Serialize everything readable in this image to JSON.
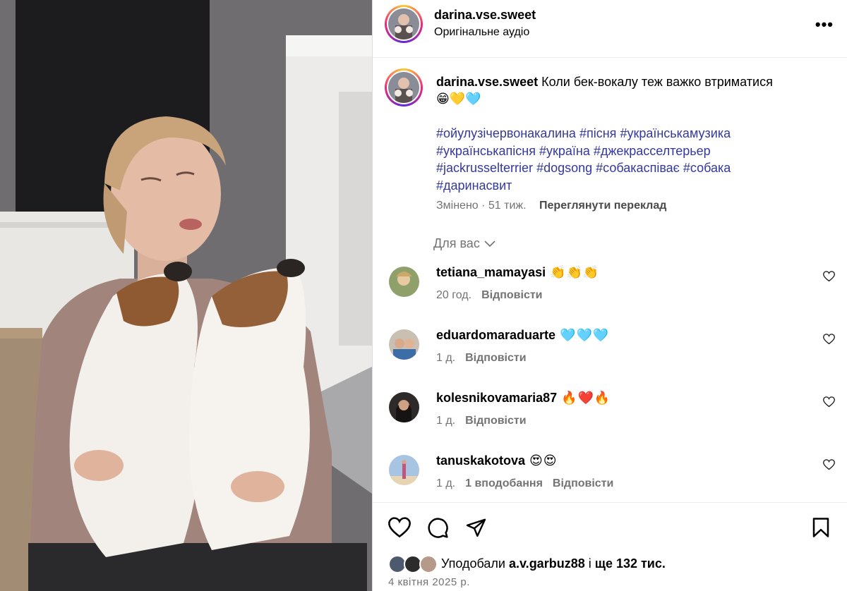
{
  "post": {
    "author": "darina.vse.sweet",
    "audio": "Оригінальне аудіо",
    "more_label": "•••",
    "caption_text": "Коли бек-вокалу теж важко втриматися",
    "caption_emoji": "😁💛🩵",
    "hashtags": [
      "#ойулузічервонакалина",
      "#пісня",
      "#українськамузика",
      "#українськапісня",
      "#україна",
      "#джекрасселтерьер",
      "#jackrusselterrier",
      "#dogsong",
      "#собакаспіває",
      "#собака",
      "#даринасвит"
    ],
    "edited": "Змінено · 51 тиж.",
    "translate": "Переглянути переклад",
    "for_you": "Для вас"
  },
  "comments": [
    {
      "user": "tetiana_mamayasi",
      "text": "👏👏👏",
      "time": "20 год.",
      "likes": "",
      "reply": "Відповісти"
    },
    {
      "user": "eduardomaraduarte",
      "text": "🩵🩵🩵",
      "time": "1 д.",
      "likes": "",
      "reply": "Відповісти"
    },
    {
      "user": "kolesnikovamaria87",
      "text": "🔥❤️🔥",
      "time": "1 д.",
      "likes": "",
      "reply": "Відповісти"
    },
    {
      "user": "tanuskakotova",
      "text": "😍😍",
      "time": "1 д.",
      "likes": "1 вподобання",
      "reply": "Відповісти"
    }
  ],
  "likes_summary": {
    "prefix": "Уподобали",
    "user": "a.v.garbuz88",
    "middle": "і",
    "count": "ще 132 тис."
  },
  "date": "4 квітня 2025 р.",
  "icons": {
    "like": "heart-icon",
    "comment": "comment-icon",
    "share": "send-icon",
    "save": "bookmark-icon",
    "more": "more-icon",
    "chevron": "chevron-down-icon"
  },
  "colors": {
    "hashtag": "#34389c",
    "meta": "#737373",
    "story_ring": [
      "#f9ce34",
      "#ee2a7b",
      "#6228d7"
    ]
  }
}
